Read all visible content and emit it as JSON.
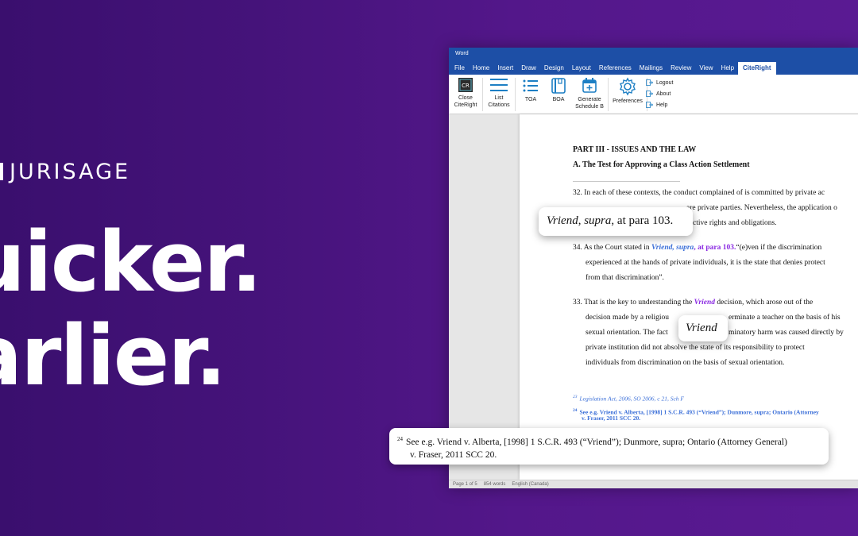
{
  "brand": {
    "name": "JURISAGE"
  },
  "headline": {
    "line1": "uicker.",
    "line2": "arlier."
  },
  "word": {
    "title": "Word",
    "menu": [
      "File",
      "Home",
      "Insert",
      "Draw",
      "Design",
      "Layout",
      "References",
      "Mailings",
      "Review",
      "View",
      "Help",
      "CiteRight"
    ],
    "ribbon": {
      "close_line1": "Close",
      "close_line2": "CiteRight",
      "list_line1": "List",
      "list_line2": "Citations",
      "toa": "TOA",
      "boa": "BOA",
      "generate_line1": "Generate",
      "generate_line2": "Schedule B",
      "preferences": "Preferences",
      "logout": "Logout",
      "about": "About",
      "help": "Help"
    },
    "doc": {
      "heading1": "PART III - ISSUES AND THE LAW",
      "heading2": "A. The Test for Approving a Class Action Settlement",
      "p32_l1_num": "32.",
      "p32_l1": "In each of these contexts, the conduct complained of is committed by private ac",
      "p32_l2": "are private parties. Nevertheless, the application o",
      "p32_l3": "ctive rights and obligations.",
      "p34_num": "34.",
      "p34_pre": "As the Court stated in ",
      "p34_cite1": "Vriend",
      "p34_comma": ", ",
      "p34_cite2": "supra",
      "p34_cite3": ", at para 103.",
      "p34_post": "“(e)ven if the discrimination",
      "p34_l2": "experienced at the hands of private individuals, it is the state that denies protect",
      "p34_l3": "from that discrimination”.",
      "p33_num": "33.",
      "p33_pre": "That is the key to understanding the ",
      "p33_cite": "Vriend",
      "p33_post": " decision, which arose out of the",
      "p33_l2a": "decision made by a religiou",
      "p33_l2b": "erminate a teacher on the basis of his",
      "p33_l3a": "sexual orientation. The fact",
      "p33_l3b": "minatory harm was caused directly by",
      "p33_l4": "private institution did not absolve the state of its responsibility to protect",
      "p33_l5": "individuals from discrimination on the basis of sexual orientation.",
      "fn23_num": "23",
      "fn23": "Legislation Act, 2006, SO 2006, c 21, Sch F",
      "fn24_num": "24",
      "fn24_l1": "See e.g. Vriend v. Alberta, [1998] 1 S.C.R. 493 (“Vriend”); Dunmore, supra; Ontario (Attorney",
      "fn24_l2": "v. Fraser, 2011 SCC 20."
    },
    "status": {
      "page": "Page 1 of 5",
      "words": "854 words",
      "lang": "English (Canada)"
    }
  },
  "popups": {
    "cite_italic1": "Vriend",
    "cite_comma": ", ",
    "cite_italic2": "supra",
    "cite_rest": ", at para 103.",
    "short_name": "Vriend",
    "fn_num": "24",
    "fn_line1": "See e.g. Vriend v. Alberta, [1998] 1 S.C.R. 493 (“Vriend”); Dunmore, supra; Ontario (Attorney General)",
    "fn_line2": "v. Fraser, 2011 SCC 20."
  },
  "colors": {
    "accent_word": "#1d4fa6",
    "cite_blue": "#3b6fd8",
    "cite_purple": "#8b2be2",
    "bg_purple": "#4a1480"
  }
}
